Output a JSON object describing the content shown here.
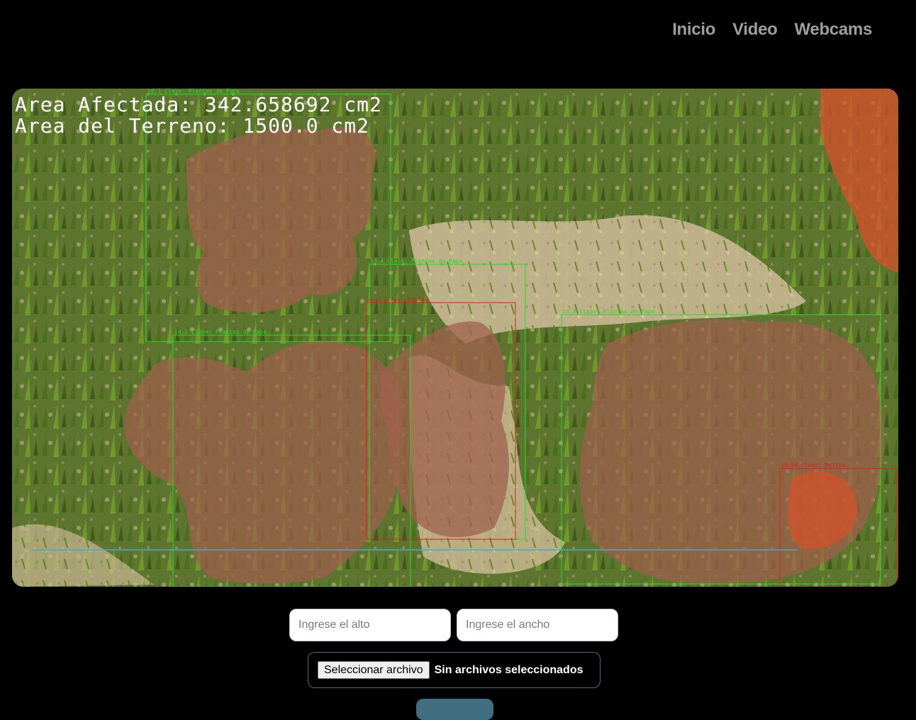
{
  "nav": {
    "items": [
      "Inicio",
      "Video",
      "Webcams"
    ]
  },
  "viewer": {
    "area_affected": "Area Afectada: 342.658692 cm2",
    "area_field": "Area del Terreno: 1500.0 cm2",
    "detections": [
      {
        "label": "id:1 Clase: Plantas de Papa",
        "class": "papa"
      },
      {
        "label": "id:4 Clase: Plantas de Papa",
        "class": "papa"
      },
      {
        "label": "id:6 Clase: Maleza",
        "class": "maleza"
      },
      {
        "label": "id:2 Clase: Plantas de Papa",
        "class": "papa"
      },
      {
        "label": "id:3 Clase: Plantas de Papa",
        "class": "papa"
      },
      {
        "label": "id:66 Clase: Maleza",
        "class": "maleza"
      }
    ],
    "colors": {
      "papa_box": "#22dd22",
      "maleza_box": "#e02020",
      "line": "#4aa8c8"
    }
  },
  "form": {
    "alto_placeholder": "Ingrese el alto",
    "ancho_placeholder": "Ingrese el ancho",
    "file_button": "Seleccionar archivo",
    "file_status": "Sin archivos seleccionados"
  }
}
